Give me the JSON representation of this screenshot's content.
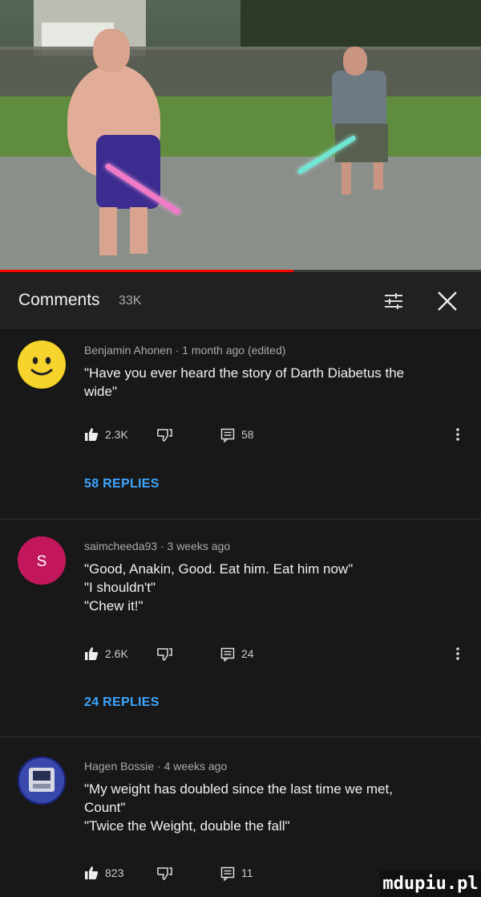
{
  "video": {
    "progress": 0.61,
    "colors": {
      "progress": "#ff0000",
      "saber_left": "#f07ac6",
      "saber_right": "#6ee6d4"
    }
  },
  "panel": {
    "title": "Comments",
    "count": "33K",
    "sort_icon": "sort-icon",
    "close_icon": "close-icon"
  },
  "comments": [
    {
      "author": "Benjamin Ahonen",
      "time": "1 month ago (edited)",
      "text": [
        "\"Have you ever heard the story of Darth Diabetus the",
        "wide\""
      ],
      "likes": "2.3K",
      "replies": "58",
      "replies_link": "58 REPLIES",
      "avatar": {
        "kind": "emoji-smiley",
        "color": "#f3d327"
      }
    },
    {
      "author": "saimcheeda93",
      "time": "3 weeks ago",
      "text": [
        "\"Good, Anakin, Good. Eat him. Eat him now\"",
        "\"I shouldn't\"",
        "\"Chew it!\""
      ],
      "likes": "2.6K",
      "replies": "24",
      "replies_link": "24 REPLIES",
      "avatar": {
        "kind": "letter",
        "letter": "S",
        "color": "#c2185b"
      }
    },
    {
      "author": "Hagen Bossie",
      "time": "4 weeks ago",
      "text": [
        "\"My weight has doubled since the last time we met,",
        "Count\"",
        "\"Twice the Weight, double the fall\""
      ],
      "likes": "823",
      "replies": "11",
      "avatar": {
        "kind": "robot",
        "color": "#3f51b5"
      }
    }
  ],
  "watermark": "mdupiu.pl"
}
